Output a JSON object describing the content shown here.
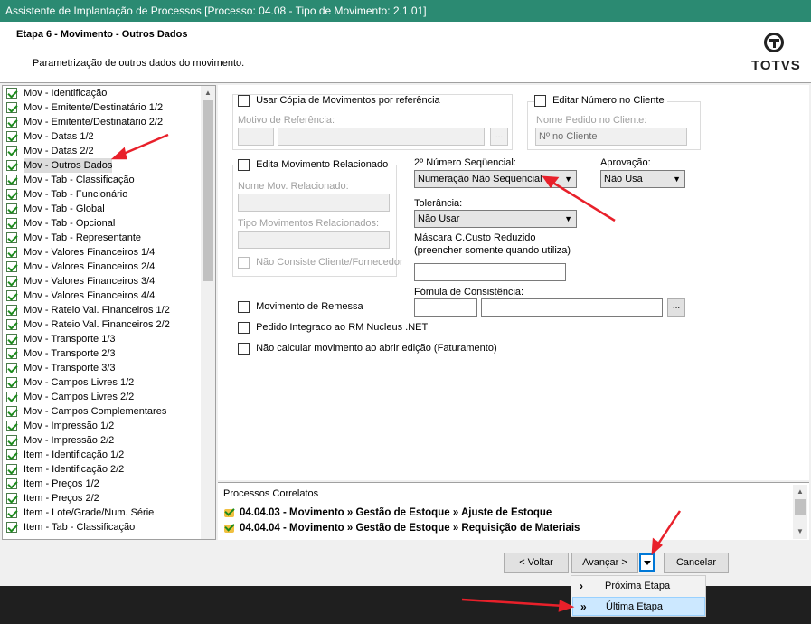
{
  "window": {
    "title": "Assistente de Implantação de Processos [Processo: 04.08 - Tipo de Movimento: 2.1.01]"
  },
  "header": {
    "step_title": "Etapa 6 - Movimento - Outros Dados",
    "step_desc": "Parametrização de outros dados do movimento.",
    "logo_text": "TOTVS"
  },
  "tree": {
    "items": [
      "Mov - Identificação",
      "Mov - Emitente/Destinatário 1/2",
      "Mov - Emitente/Destinatário 2/2",
      "Mov - Datas 1/2",
      "Mov - Datas 2/2",
      "Mov - Outros Dados",
      "Mov - Tab - Classificação",
      "Mov - Tab - Funcionário",
      "Mov - Tab - Global",
      "Mov - Tab - Opcional",
      "Mov - Tab - Representante",
      "Mov - Valores Financeiros 1/4",
      "Mov - Valores Financeiros 2/4",
      "Mov - Valores Financeiros 3/4",
      "Mov - Valores Financeiros 4/4",
      "Mov - Rateio Val. Financeiros 1/2",
      "Mov - Rateio Val. Financeiros 2/2",
      "Mov - Transporte 1/3",
      "Mov - Transporte 2/3",
      "Mov - Transporte 3/3",
      "Mov - Campos Livres 1/2",
      "Mov - Campos Livres 2/2",
      "Mov - Campos Complementares",
      "Mov - Impressão 1/2",
      "Mov - Impressão 2/2",
      "Item - Identificação 1/2",
      "Item - Identificação 2/2",
      "Item - Preços 1/2",
      "Item - Preços 2/2",
      "Item - Lote/Grade/Num. Série",
      "Item - Tab - Classificação"
    ],
    "selected": "Mov - Outros Dados"
  },
  "form": {
    "copia_label": "Usar Cópia de Movimentos por referência",
    "motivo_label": "Motivo de Referência:",
    "ellipsis": "...",
    "editar_numero_label": "Editar Número no Cliente",
    "pedido_label": "Nome Pedido no Cliente:",
    "pedido_value": "Nº no Cliente",
    "edita_rel_label": "Edita Movimento Relacionado",
    "nome_mov_label": "Nome Mov. Relacionado:",
    "tipo_mov_label": "Tipo Movimentos Relacionados:",
    "nao_consiste_label": "Não Consiste Cliente/Fornecedor",
    "seq_label": "2º Número Seqüencial:",
    "seq_value": "Numeração Não Sequencial",
    "aprov_label": "Aprovação:",
    "aprov_value": "Não Usa",
    "toler_label": "Tolerância:",
    "toler_value": "Não Usar",
    "mascara_label_1": "Máscara C.Custo Reduzido",
    "mascara_label_2": "(preencher somente quando utiliza)",
    "formula_label": "Fómula de Consistência:",
    "remessa_label": "Movimento de Remessa",
    "pedido_rm_label": "Pedido Integrado ao RM Nucleus .NET",
    "nao_calc_label": "Não calcular movimento ao abrir edição (Faturamento)"
  },
  "correlated": {
    "title": "Processos Correlatos",
    "rows": [
      "04.04.03 - Movimento » Gestão de Estoque » Ajuste de Estoque",
      "04.04.04 - Movimento » Gestão de Estoque » Requisição de Materiais"
    ]
  },
  "buttons": {
    "voltar": "< Voltar",
    "avancar": "Avançar >",
    "cancelar": "Cancelar"
  },
  "menu": {
    "items": [
      {
        "icon": "›",
        "label": "Próxima Etapa"
      },
      {
        "icon": "»",
        "label": "Última Etapa"
      }
    ]
  },
  "colors": {
    "title_bar": "#2b8a72",
    "annotation_arrow": "#e8202a",
    "focus": "#0078d7"
  }
}
